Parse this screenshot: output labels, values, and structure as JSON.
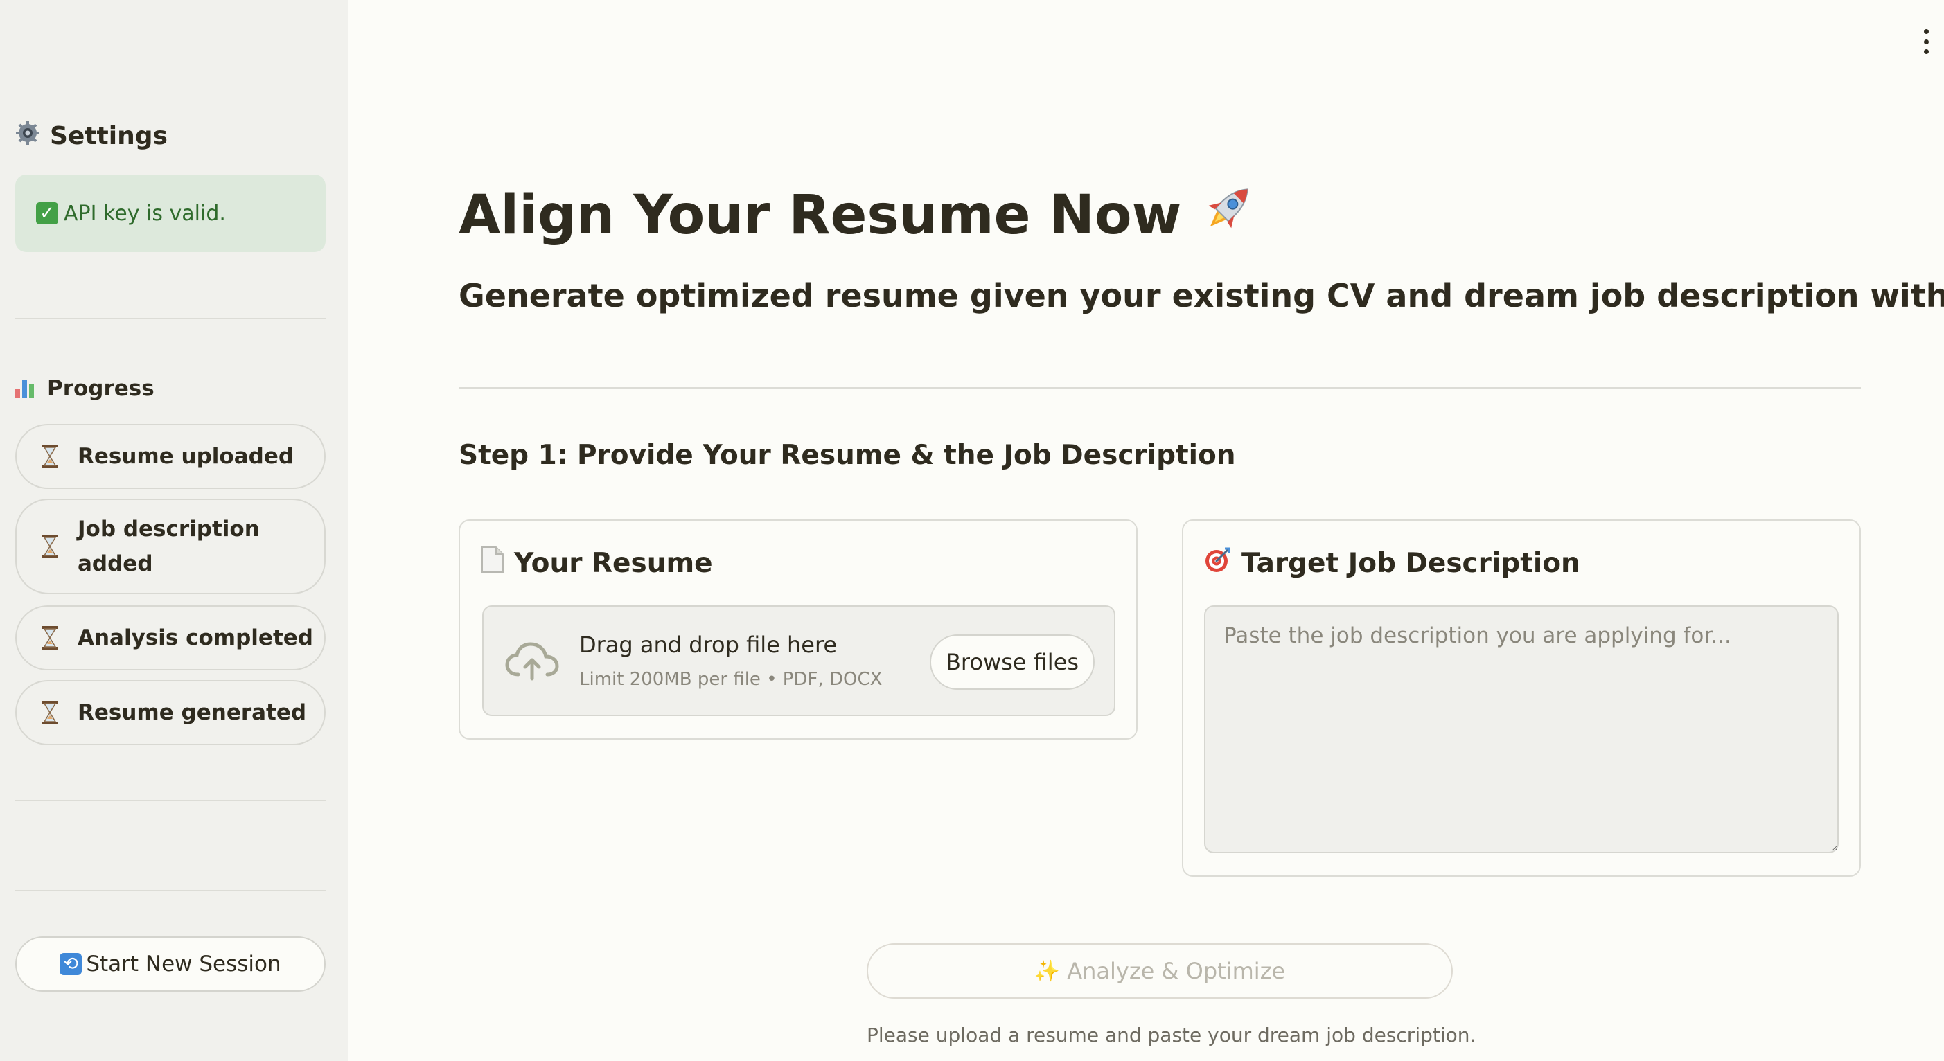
{
  "sidebar": {
    "settings_icon": "gear-icon",
    "settings_title": "Settings",
    "api_status": "API key is valid.",
    "progress_title": "Progress",
    "progress_items": [
      {
        "label": "Resume uploaded",
        "status": "pending"
      },
      {
        "label": "Job description added",
        "status": "pending"
      },
      {
        "label": "Analysis completed",
        "status": "pending"
      },
      {
        "label": "Resume generated",
        "status": "pending"
      }
    ],
    "new_session_label": "Start New Session"
  },
  "main": {
    "title": "Align Your Resume Now",
    "subtitle": "Generate optimized resume given your existing CV and dream job description with AI",
    "step_title": "Step 1: Provide Your Resume & the Job Description",
    "resume_card": {
      "title": "Your Resume",
      "dropzone_text": "Drag and drop file here",
      "dropzone_limit": "Limit 200MB per file • PDF, DOCX",
      "browse_label": "Browse files"
    },
    "job_card": {
      "title": "Target Job Description",
      "placeholder": "Paste the job description you are applying for...",
      "value": ""
    },
    "analyze_label": "Analyze & Optimize",
    "analyze_enabled": false,
    "help_text": "Please upload a resume and paste your dream job description."
  },
  "colors": {
    "background": "#fcfcf8",
    "sidebar_bg": "#f1f1ed",
    "success_bg": "#dde9dc",
    "success_text": "#2f6b2c",
    "text": "#2f2b1f",
    "muted": "#8a877c"
  }
}
